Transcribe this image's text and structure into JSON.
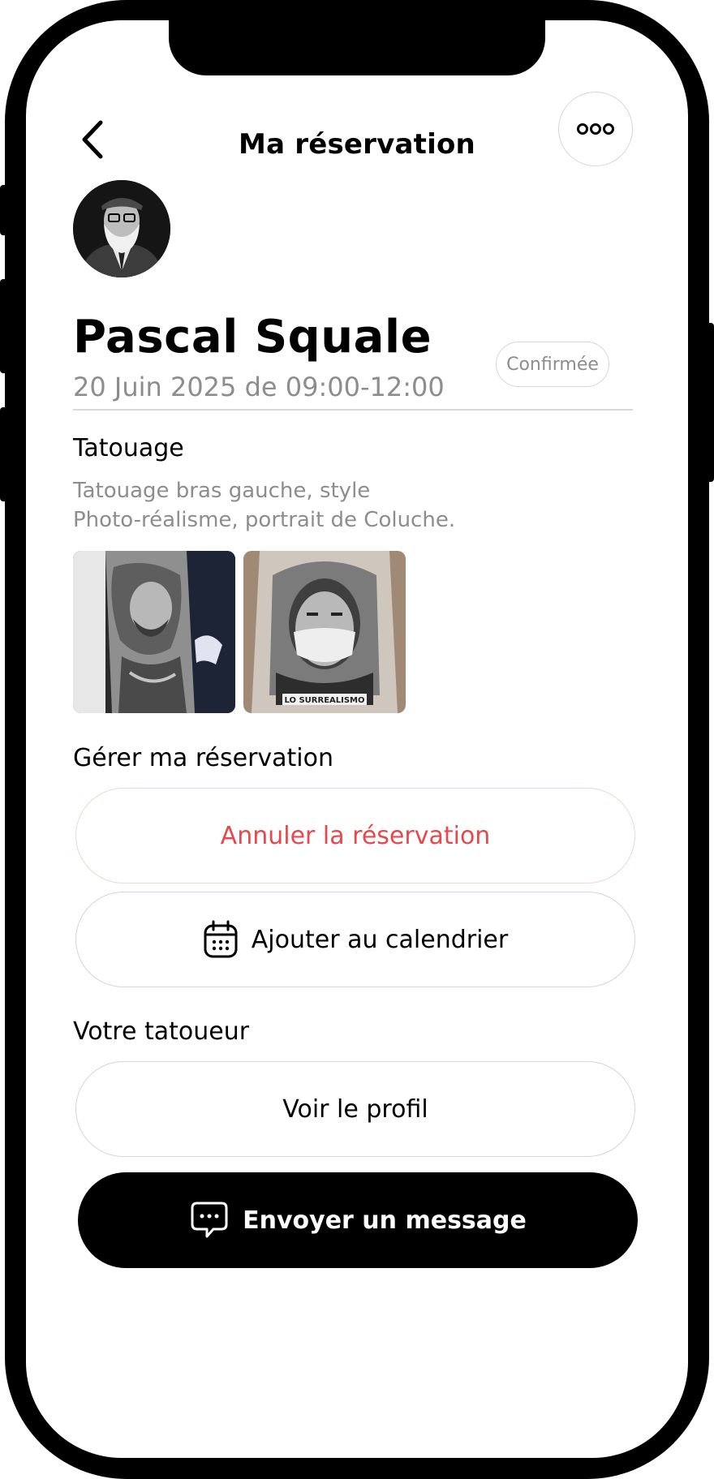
{
  "header": {
    "title": "Ma réservation"
  },
  "artist": {
    "name": "Pascal Squale"
  },
  "booking": {
    "date": "20 Juin 2025 de 09:00-12:00",
    "status": "Confirmée"
  },
  "tattoo": {
    "section_title": "Tatouage",
    "description_line1": "Tatouage bras gauche, style",
    "description_line2": "Photo-réalisme, portrait de Coluche.",
    "reference_images": [
      {
        "icon": "tattoo-sleeve-image"
      },
      {
        "icon": "tattoo-portrait-image",
        "caption": "LO SURREALISMO"
      }
    ]
  },
  "manage": {
    "section_title": "Gérer ma réservation",
    "cancel_label": "Annuler la réservation",
    "calendar_label": "Ajouter au calendrier"
  },
  "tattoo_artist": {
    "section_title": "Votre tatoueur",
    "profile_label": "Voir le profil",
    "message_label": "Envoyer un message"
  },
  "colors": {
    "accent_danger": "#e5494d",
    "muted_text": "#8d8d8d",
    "primary_button": "#000000"
  },
  "icons": {
    "back": "chevron-left-icon",
    "more": "more-icon",
    "calendar": "calendar-icon",
    "message": "chat-bubble-icon"
  }
}
